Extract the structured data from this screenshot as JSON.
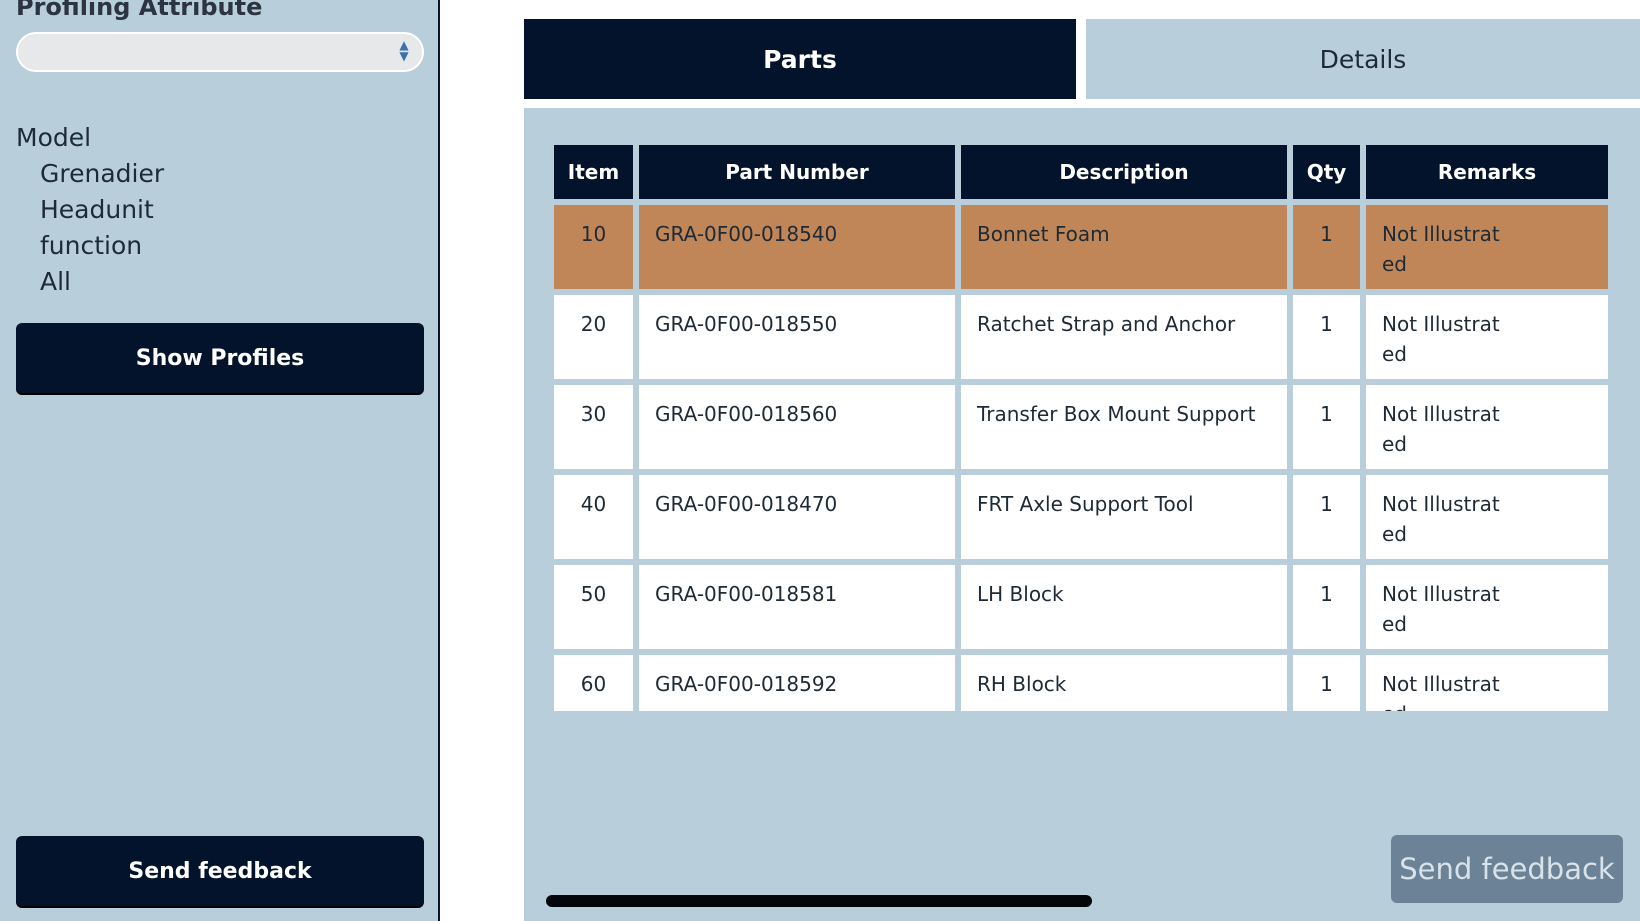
{
  "sidebar": {
    "profiling_attribute_label": "Profiling Attribute",
    "profiling_select_value": "",
    "model_label": "Model",
    "model_values": [
      "Grenadier",
      "Headunit",
      "function",
      "All"
    ],
    "show_profiles_label": "Show  Profiles",
    "send_feedback_label": "Send feedback"
  },
  "tabs": [
    {
      "label": "Parts",
      "active": true
    },
    {
      "label": "Details",
      "active": false
    }
  ],
  "table": {
    "headers": [
      "Item",
      "Part Number",
      "Description",
      "Qty",
      "Remarks"
    ],
    "rows": [
      {
        "item": "10",
        "part_number": "GRA-0F00-018540",
        "description": "Bonnet Foam",
        "qty": "1",
        "remarks": "Not Illustrated",
        "highlighted": true
      },
      {
        "item": "20",
        "part_number": "GRA-0F00-018550",
        "description": "Ratchet Strap and Anchor",
        "qty": "1",
        "remarks": "Not Illustrated"
      },
      {
        "item": "30",
        "part_number": "GRA-0F00-018560",
        "description": "Transfer Box Mount Support",
        "qty": "1",
        "remarks": "Not Illustrated"
      },
      {
        "item": "40",
        "part_number": "GRA-0F00-018470",
        "description": "FRT Axle Support Tool",
        "qty": "1",
        "remarks": "Not Illustrated"
      },
      {
        "item": "50",
        "part_number": "GRA-0F00-018581",
        "description": "LH Block",
        "qty": "1",
        "remarks": "Not Illustrated"
      },
      {
        "item": "60",
        "part_number": "GRA-0F00-018592",
        "description": "RH Block",
        "qty": "1",
        "remarks": "Not Illustrated"
      }
    ]
  },
  "floating_feedback_label": "Send feedback",
  "colors": {
    "navy": "#02132b",
    "panel": "#b8cfdb",
    "highlight": "#c08658"
  }
}
